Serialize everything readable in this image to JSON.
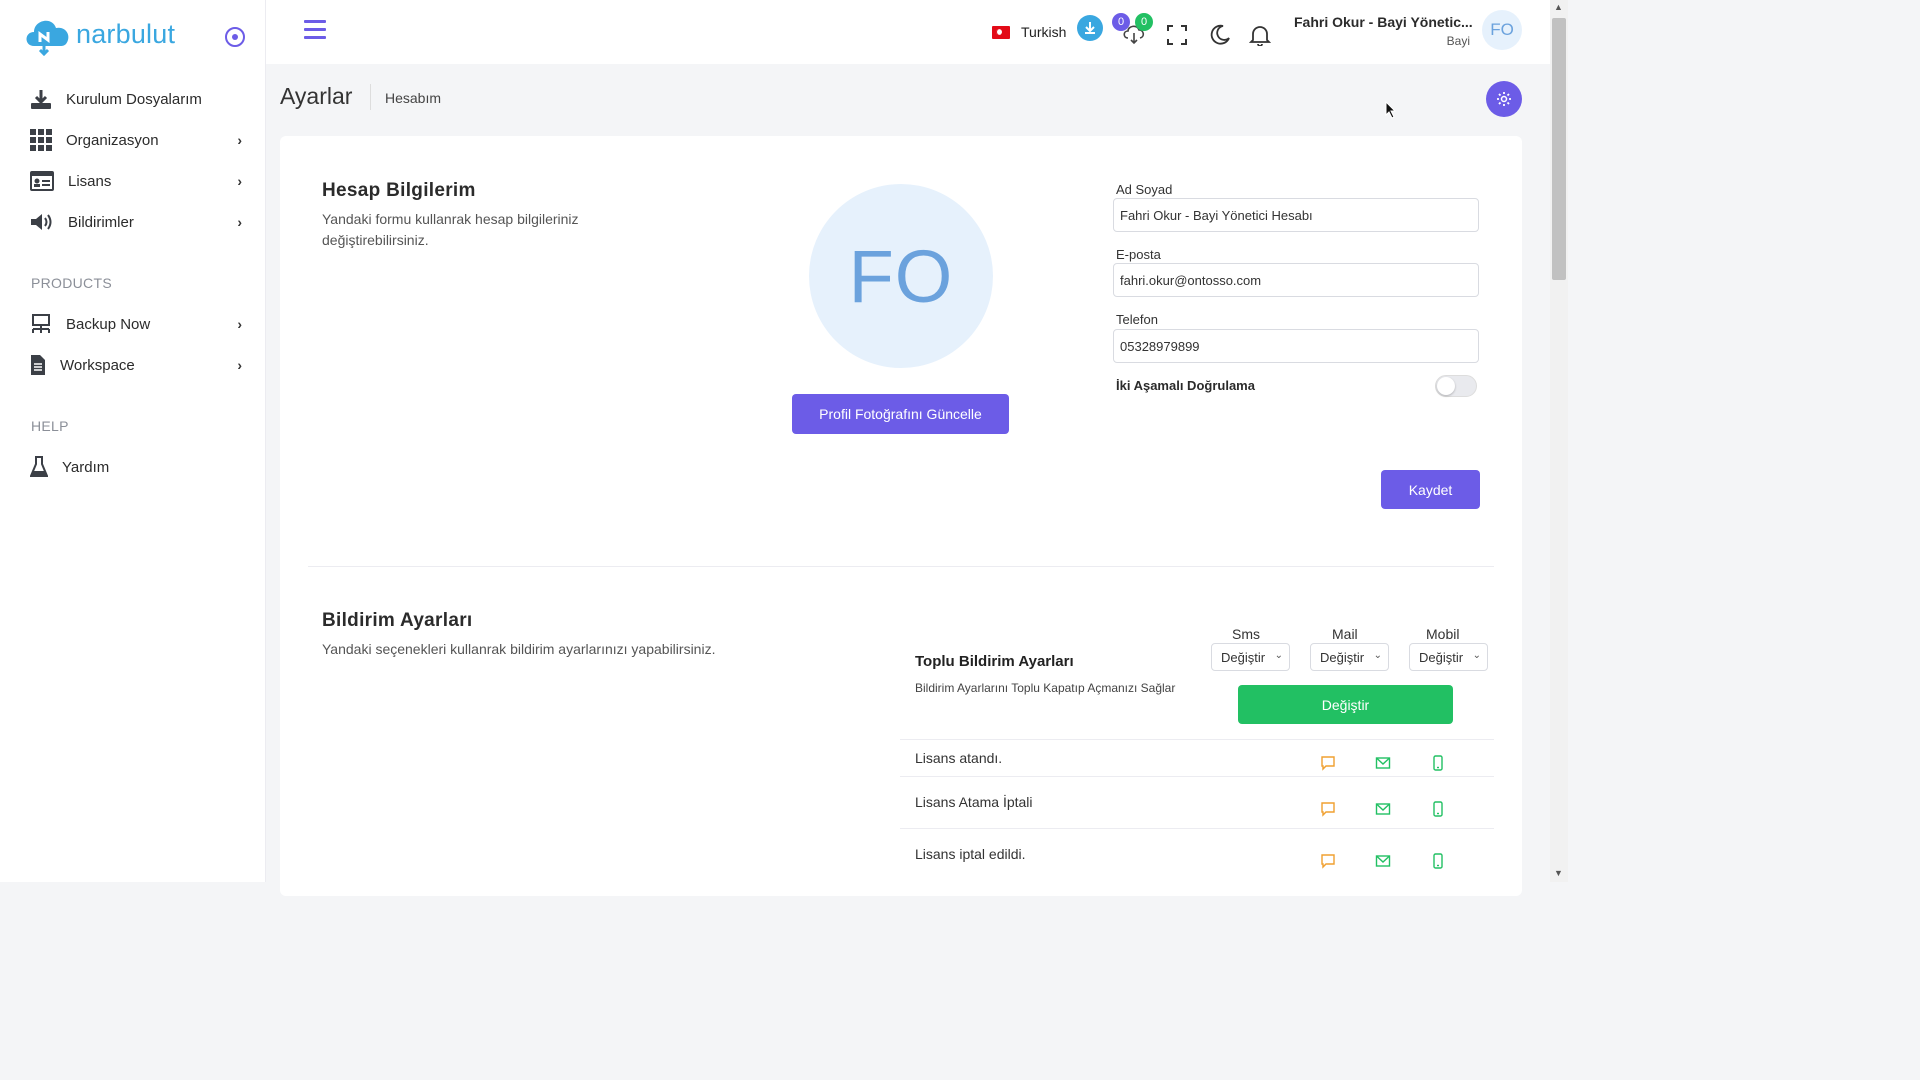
{
  "brand": {
    "name": "narbulut",
    "color": "#3aa7e0",
    "accent": "#6c5ce7"
  },
  "sidebar": {
    "items": [
      {
        "label": "Kurulum Dosyalarım",
        "icon": "download-icon"
      },
      {
        "label": "Organizasyon",
        "icon": "grid-icon"
      },
      {
        "label": "Lisans",
        "icon": "id-card-icon"
      },
      {
        "label": "Bildirimler",
        "icon": "speaker-icon"
      }
    ],
    "products_title": "PRODUCTS",
    "products": [
      {
        "label": "Backup Now",
        "icon": "network-icon"
      },
      {
        "label": "Workspace",
        "icon": "file-icon"
      }
    ],
    "help_title": "HELP",
    "help": [
      {
        "label": "Yardım",
        "icon": "flask-icon"
      }
    ]
  },
  "topbar": {
    "language": "Turkish",
    "upload_count": "0",
    "download_count": "0",
    "user_name": "Fahri Okur - Bayi Yönetic...",
    "user_role": "Bayi",
    "avatar_initials": "FO"
  },
  "header": {
    "title": "Ayarlar",
    "breadcrumb": "Hesabım"
  },
  "account": {
    "title": "Hesap Bilgilerim",
    "description": "Yandaki formu kullanrak hesap bilgileriniz değiştirebilirsiniz.",
    "avatar_initials": "FO",
    "update_photo_label": "Profil Fotoğrafını Güncelle",
    "name_label": "Ad Soyad",
    "name_value": "Fahri Okur - Bayi Yönetici Hesabı",
    "email_label": "E-posta",
    "email_value": "fahri.okur@ontosso.com",
    "phone_label": "Telefon",
    "phone_value": "05328979899",
    "twofa_label": "İki Aşamalı Doğrulama",
    "twofa_enabled": false,
    "save_label": "Kaydet"
  },
  "notifications": {
    "title": "Bildirim Ayarları",
    "description": "Yandaki seçenekleri kullanrak bildirim ayarlarınızı yapabilirsiniz.",
    "columns": [
      "Sms",
      "Mail",
      "Mobil"
    ],
    "select_value": "Değiştir",
    "bulk_title": "Toplu Bildirim Ayarları",
    "bulk_desc": "Bildirim Ayarlarını Toplu Kapatıp Açmanızı Sağlar",
    "apply_label": "Değiştir",
    "rows": [
      {
        "label": "Lisans atandı."
      },
      {
        "label": "Lisans Atama İptali"
      },
      {
        "label": "Lisans iptal edildi."
      }
    ],
    "colors": {
      "sms": "#f0a030",
      "mail": "#22c063",
      "mobile": "#22c063"
    }
  }
}
